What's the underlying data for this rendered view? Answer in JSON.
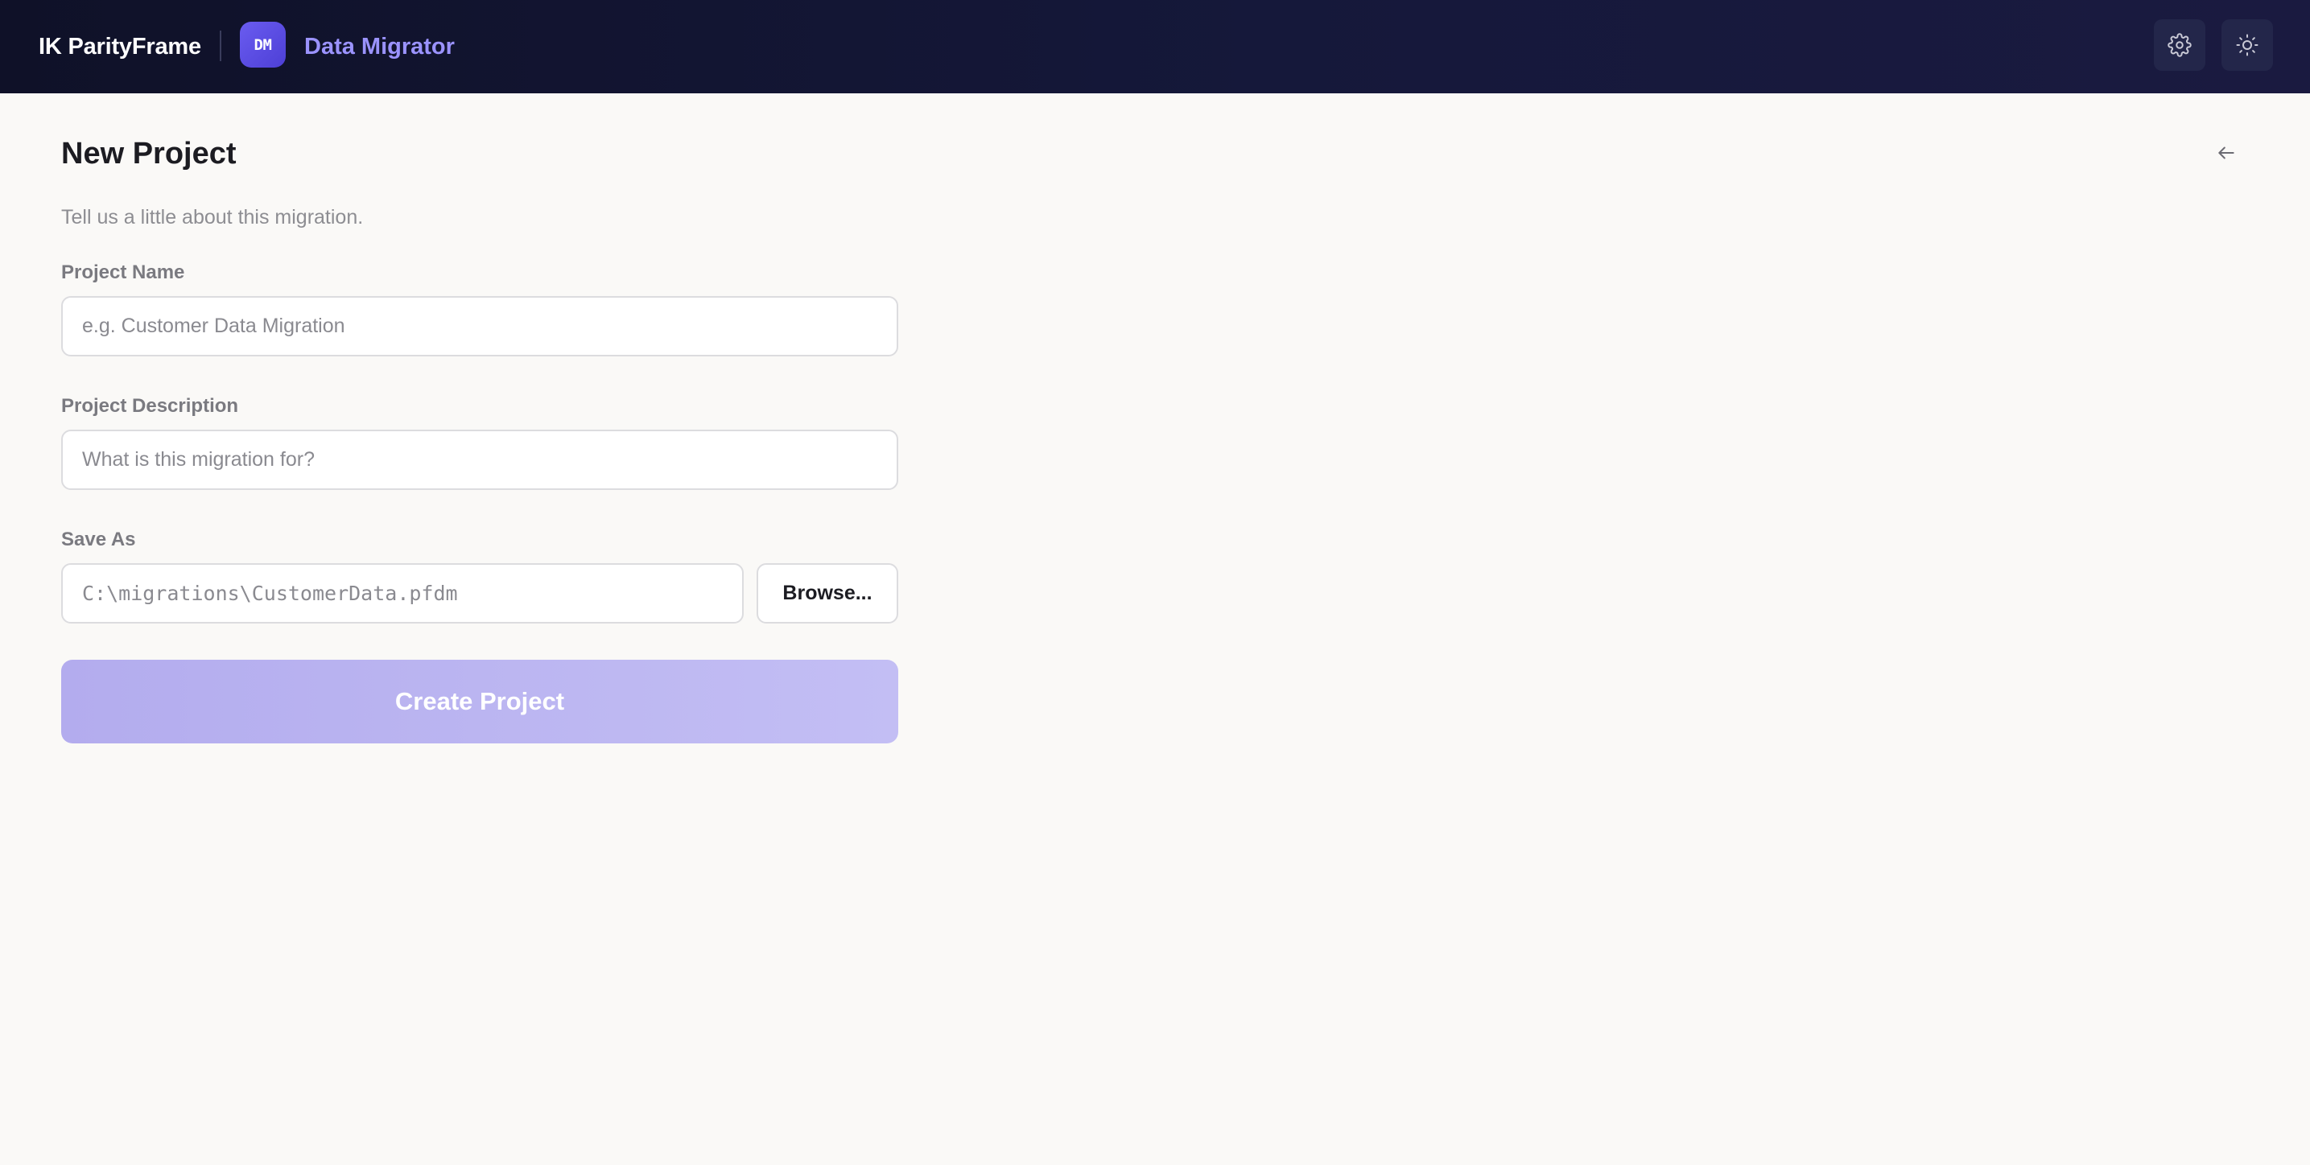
{
  "header": {
    "brand": "IK ParityFrame",
    "app_badge": "DM",
    "app_name": "Data Migrator",
    "settings_icon": "gear-icon",
    "theme_icon": "sun-icon"
  },
  "page": {
    "title": "New Project",
    "back_icon": "arrow-left-icon",
    "subtitle": "Tell us a little about this migration."
  },
  "form": {
    "project_name": {
      "label": "Project Name",
      "value": "",
      "placeholder": "e.g. Customer Data Migration"
    },
    "project_description": {
      "label": "Project Description",
      "value": "",
      "placeholder": "What is this migration for?"
    },
    "save_as": {
      "label": "Save As",
      "value": "",
      "placeholder": "C:\\migrations\\CustomerData.pfdm",
      "browse_label": "Browse..."
    },
    "submit_label": "Create Project",
    "submit_disabled": true
  },
  "colors": {
    "accent": "#5b4fe6",
    "accent_disabled": "#b8b2f0",
    "header_bg": "#11132e",
    "page_bg": "#faf9f7"
  }
}
